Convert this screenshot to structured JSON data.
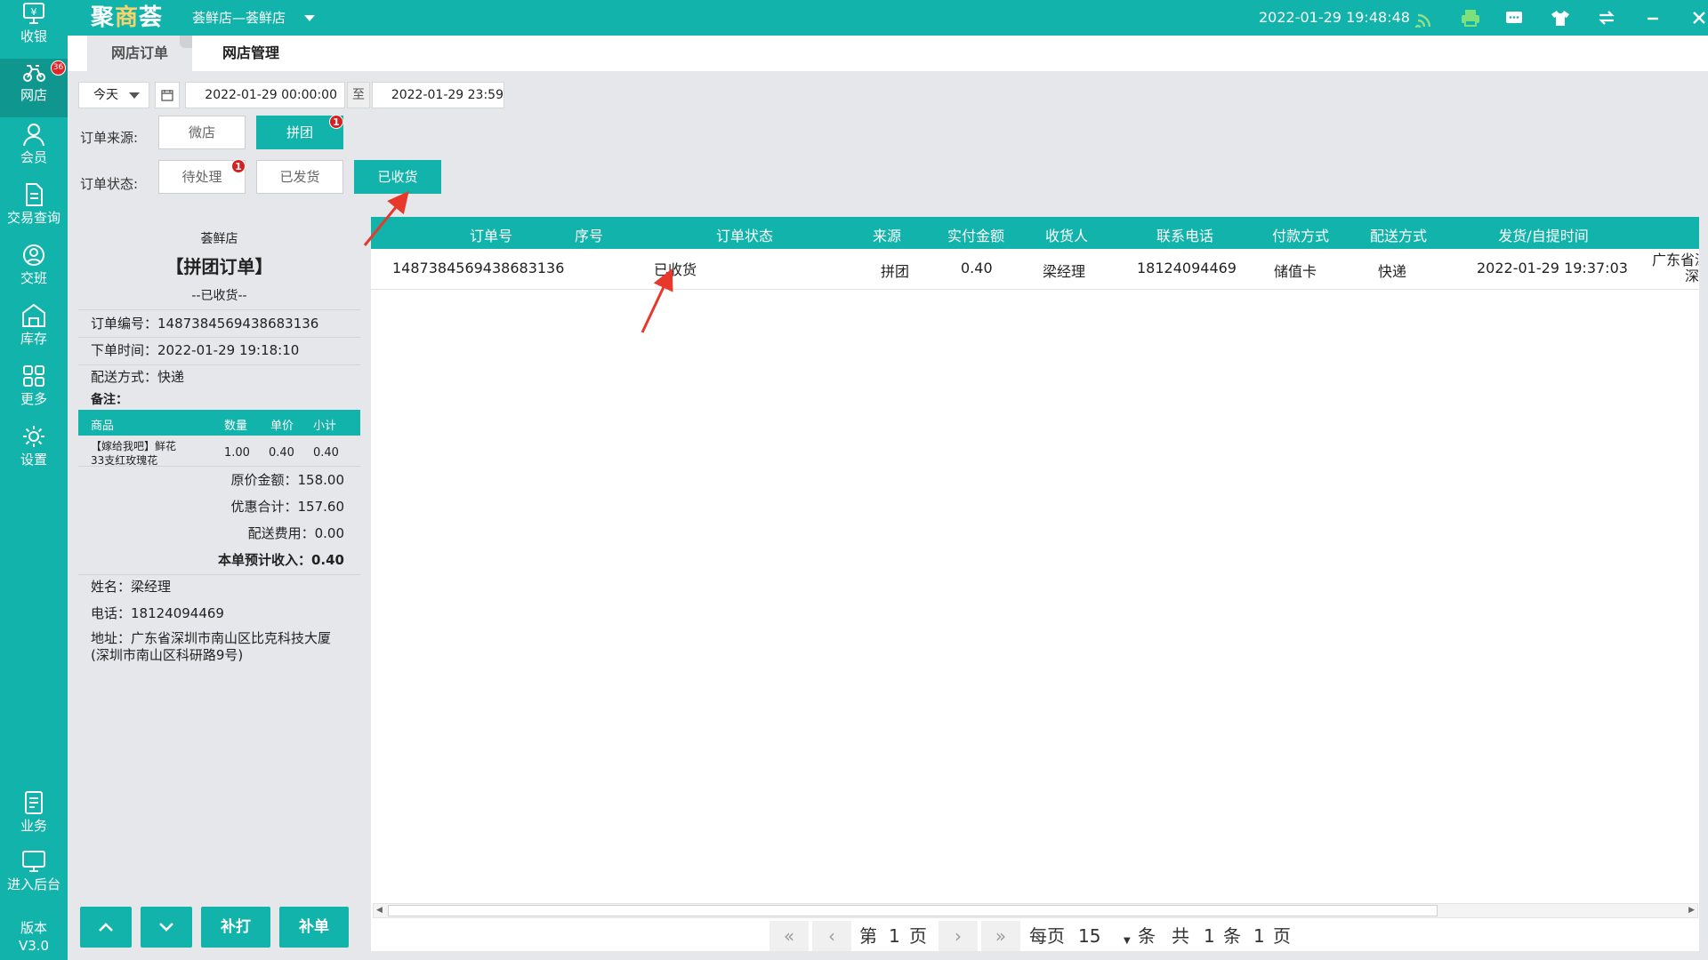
{
  "sidebar": {
    "items": [
      {
        "label": "收银",
        "icon": "cash-register-icon"
      },
      {
        "label": "网店",
        "icon": "delivery-bike-icon",
        "badge": "36"
      },
      {
        "label": "会员",
        "icon": "member-person-icon"
      },
      {
        "label": "交易查询",
        "icon": "document-icon"
      },
      {
        "label": "交班",
        "icon": "shift-handover-icon"
      },
      {
        "label": "库存",
        "icon": "warehouse-icon"
      },
      {
        "label": "更多",
        "icon": "grid-icon"
      },
      {
        "label": "设置",
        "icon": "gear-icon"
      },
      {
        "label": "业务",
        "icon": "business-book-icon"
      },
      {
        "label": "进入后台",
        "icon": "monitor-icon"
      }
    ],
    "version_label": "版本",
    "version_value": "V3.0"
  },
  "topbar": {
    "logo_a": "聚",
    "logo_b": "商",
    "logo_c": "荟",
    "store": "荟鲜店—荟鲜店",
    "datetime": "2022-01-29 19:48:48",
    "icons": [
      "wifi-signal-icon",
      "printer-icon",
      "message-icon",
      "shirt-skin-icon",
      "swap-icon",
      "minimize-icon",
      "close-icon"
    ]
  },
  "tabs": [
    {
      "label": "网店订单"
    },
    {
      "label": "网店管理"
    }
  ],
  "filters": {
    "period": "今天",
    "date_from": "2022-01-29 00:00:00",
    "to_label": "至",
    "date_to": "2022-01-29 23:59",
    "source_label": "订单来源:",
    "sources": [
      {
        "label": "微店",
        "selected": false
      },
      {
        "label": "拼团",
        "selected": true,
        "badge": "1"
      }
    ],
    "status_label": "订单状态:",
    "statuses": [
      {
        "label": "待处理",
        "selected": false,
        "badge": "1"
      },
      {
        "label": "已发货",
        "selected": false
      },
      {
        "label": "已收货",
        "selected": true
      }
    ]
  },
  "receipt": {
    "store": "荟鲜店",
    "title": "【拼团订单】",
    "status": "--已收货--",
    "order_no": "订单编号：1487384569438683136",
    "order_time": "下单时间：2022-01-29 19:18:10",
    "delivery": "配送方式：快递",
    "remark": "备注：",
    "item_headers": [
      "商品",
      "数量",
      "单价",
      "小计"
    ],
    "items": [
      {
        "name1": "【嫁给我吧】鲜花",
        "name2": "33支红玫瑰花",
        "qty": "1.00",
        "price": "0.40",
        "subtotal": "0.40"
      }
    ],
    "original_label": "原价金额：",
    "original": "158.00",
    "discount_label": "优惠合计：",
    "discount": "157.60",
    "shipping_label": "配送费用：",
    "shipping": "0.00",
    "income_label": "本单预计收入：",
    "income": "0.40",
    "name": "姓名：梁经理",
    "phone": "电话：18124094469",
    "address1": "地址：广东省深圳市南山区比克科技大厦",
    "address2": "(深圳市南山区科研路9号)"
  },
  "actions": {
    "up_icon": "chevron-up-icon",
    "down_icon": "chevron-down-icon",
    "reprint": "补打",
    "supplement": "补单"
  },
  "table": {
    "headers": [
      "订单号",
      "序号",
      "订单状态",
      "来源",
      "实付金额",
      "收货人",
      "联系电话",
      "付款方式",
      "配送方式",
      "发货/自提时间"
    ],
    "rows": [
      {
        "order_no": "1487384569438683136",
        "seq": "",
        "status": "已收货",
        "source": "拼团",
        "paid": "0.40",
        "receiver": "梁经理",
        "phone": "18124094469",
        "pay_method": "储值卡",
        "delivery": "快递",
        "time": "2022-01-29 19:37:03",
        "addr1": "广东省深",
        "addr2": "深"
      }
    ]
  },
  "pager": {
    "page_prefix": "第",
    "page": "1",
    "page_suffix": "页",
    "per_label": "每页",
    "per_page": "15",
    "per_unit": "条",
    "total_prefix": "共",
    "total": "1",
    "total_unit": "条",
    "pages": "1",
    "pages_unit": "页"
  },
  "colors": {
    "accent": "#12b3aa",
    "badge": "#e02626",
    "annotation_arrow": "#e8382b"
  }
}
